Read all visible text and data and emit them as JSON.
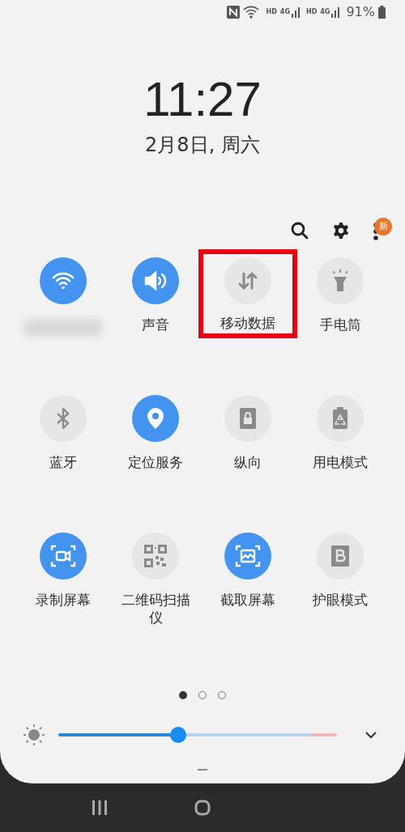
{
  "status_bar": {
    "network_labels": [
      "HD",
      "4G",
      "HD",
      "4G"
    ],
    "battery": "91%"
  },
  "clock": {
    "time": "11:27",
    "date": "2月8日, 周六"
  },
  "toolbar": {
    "badge": "新"
  },
  "tiles": [
    {
      "on": true,
      "highlighted": false
    },
    {
      "label": "声音",
      "on": true,
      "highlighted": false
    },
    {
      "label": "移动数据",
      "on": false,
      "highlighted": true
    },
    {
      "label": "手电筒",
      "on": false,
      "highlighted": false
    },
    {
      "label": "蓝牙",
      "on": false,
      "highlighted": false
    },
    {
      "label": "定位服务",
      "on": true,
      "highlighted": false
    },
    {
      "label": "纵向",
      "on": false,
      "highlighted": false
    },
    {
      "label": "用电模式",
      "on": false,
      "highlighted": false
    },
    {
      "label": "录制屏幕",
      "on": true,
      "highlighted": false
    },
    {
      "label": "二维码扫描仪",
      "on": false,
      "highlighted": false
    },
    {
      "label": "截取屏幕",
      "on": true,
      "highlighted": false
    },
    {
      "label": "护眼模式",
      "on": false,
      "highlighted": false
    }
  ],
  "pages": [
    {
      "selected": true
    },
    {
      "selected": false
    },
    {
      "selected": false
    }
  ],
  "brightness": {
    "level": 0.43
  }
}
